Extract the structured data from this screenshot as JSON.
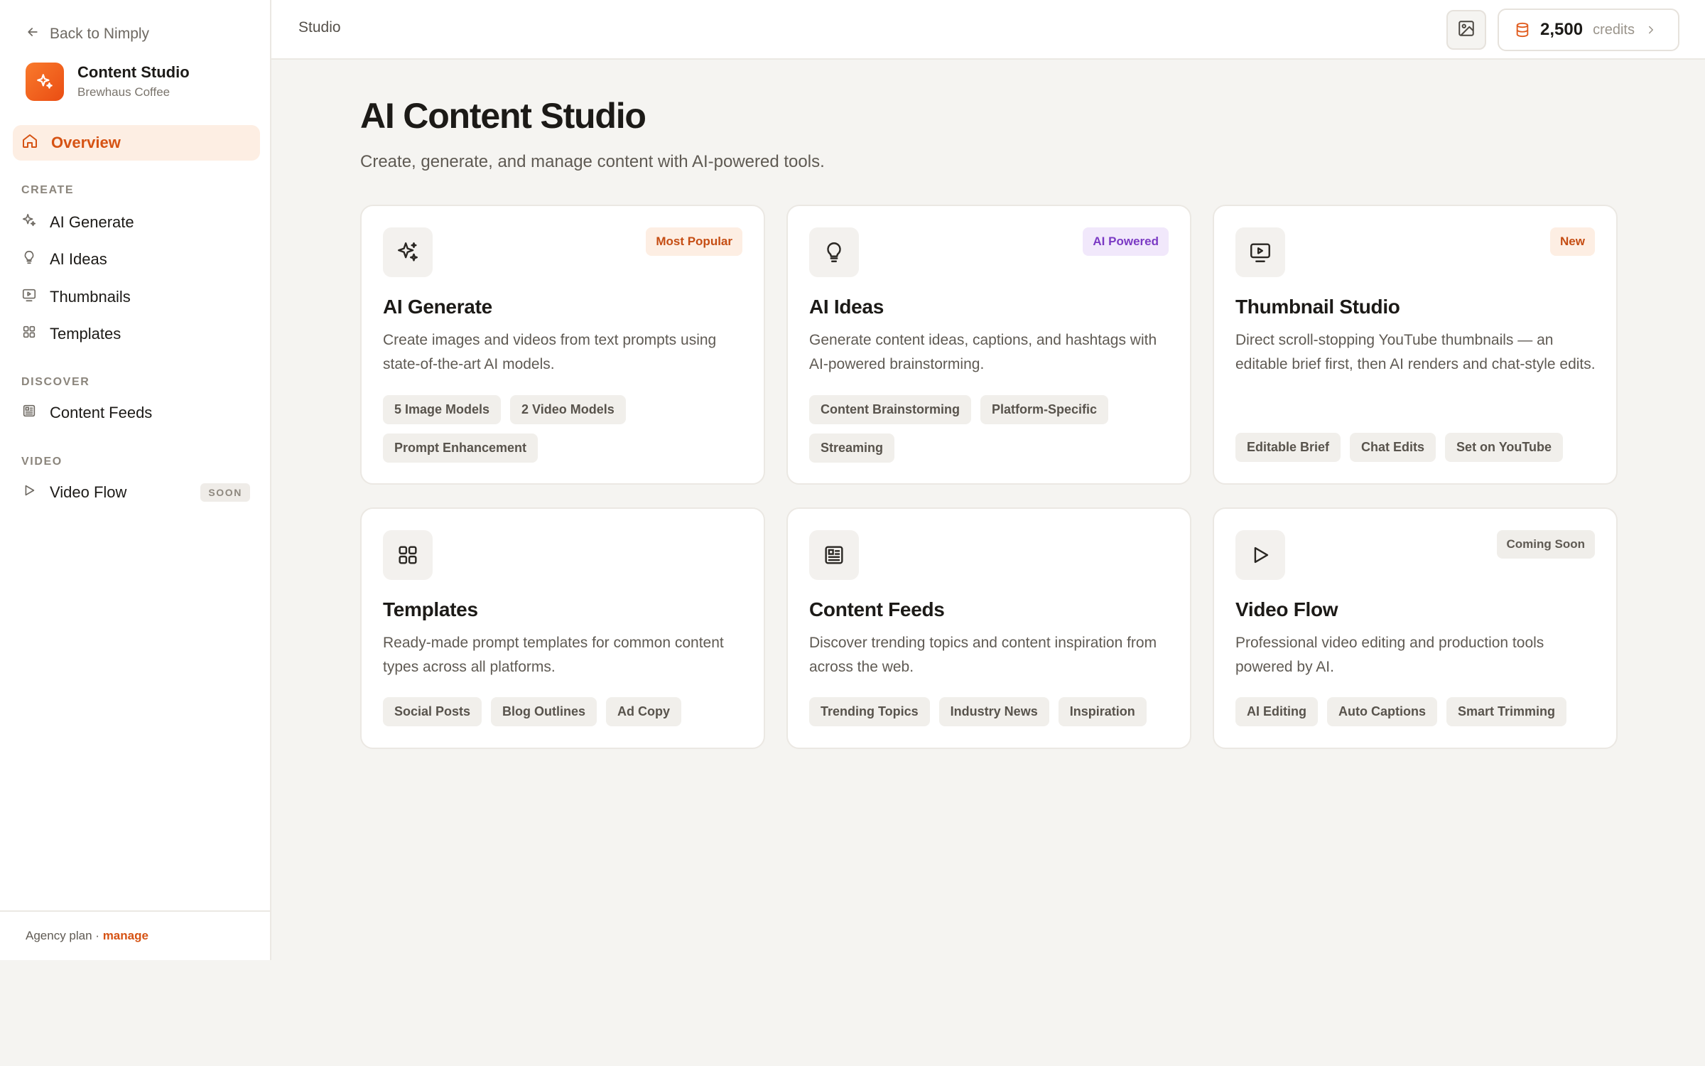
{
  "colors": {
    "accent": "#ea580c",
    "accent_soft": "#fdeee3",
    "purple": "#7b3ac4",
    "background": "#f5f4f1"
  },
  "sidebar": {
    "back_label": "Back to Nimply",
    "brand": {
      "title": "Content Studio",
      "subtitle": "Brewhaus Coffee",
      "icon": "sparkles-icon"
    },
    "active_item": {
      "label": "Overview",
      "icon": "home-icon"
    },
    "sections": [
      {
        "label": "CREATE",
        "items": [
          {
            "label": "AI Generate",
            "icon": "sparkles-icon"
          },
          {
            "label": "AI Ideas",
            "icon": "lightbulb-icon"
          },
          {
            "label": "Thumbnails",
            "icon": "monitor-play-icon"
          },
          {
            "label": "Templates",
            "icon": "grid-icon"
          }
        ]
      },
      {
        "label": "DISCOVER",
        "items": [
          {
            "label": "Content Feeds",
            "icon": "newspaper-icon"
          }
        ]
      },
      {
        "label": "VIDEO",
        "items": [
          {
            "label": "Video Flow",
            "icon": "play-icon",
            "badge": "SOON"
          }
        ]
      }
    ],
    "footer": {
      "plan": "Agency plan",
      "separator": " · ",
      "manage": "manage"
    }
  },
  "topbar": {
    "breadcrumb": "Studio",
    "gallery_icon": "image-icon",
    "credits": {
      "amount": "2,500",
      "unit": "credits",
      "icon": "database-icon"
    }
  },
  "main": {
    "title": "AI Content Studio",
    "subtitle": "Create, generate, and manage content with AI-powered tools.",
    "cards": [
      {
        "title": "AI Generate",
        "icon": "sparkles-icon",
        "badge": "Most Popular",
        "description": "Create images and videos from text prompts using state-of-the-art AI models.",
        "tags": [
          "5 Image Models",
          "2 Video Models",
          "Prompt Enhancement"
        ]
      },
      {
        "title": "AI Ideas",
        "icon": "lightbulb-icon",
        "badge": "AI Powered",
        "description": "Generate content ideas, captions, and hashtags with AI-powered brainstorming.",
        "tags": [
          "Content Brainstorming",
          "Platform-Specific",
          "Streaming"
        ]
      },
      {
        "title": "Thumbnail Studio",
        "icon": "monitor-play-icon",
        "badge": "New",
        "description": "Direct scroll-stopping YouTube thumbnails — an editable brief first, then AI renders and chat-style edits.",
        "tags": [
          "Editable Brief",
          "Chat Edits",
          "Set on YouTube"
        ]
      },
      {
        "title": "Templates",
        "icon": "grid-icon",
        "description": "Ready-made prompt templates for common content types across all platforms.",
        "tags": [
          "Social Posts",
          "Blog Outlines",
          "Ad Copy"
        ]
      },
      {
        "title": "Content Feeds",
        "icon": "newspaper-icon",
        "description": "Discover trending topics and content inspiration from across the web.",
        "tags": [
          "Trending Topics",
          "Industry News",
          "Inspiration"
        ]
      },
      {
        "title": "Video Flow",
        "icon": "play-icon",
        "badge": "Coming Soon",
        "description": "Professional video editing and production tools powered by AI.",
        "tags": [
          "AI Editing",
          "Auto Captions",
          "Smart Trimming"
        ]
      }
    ]
  }
}
